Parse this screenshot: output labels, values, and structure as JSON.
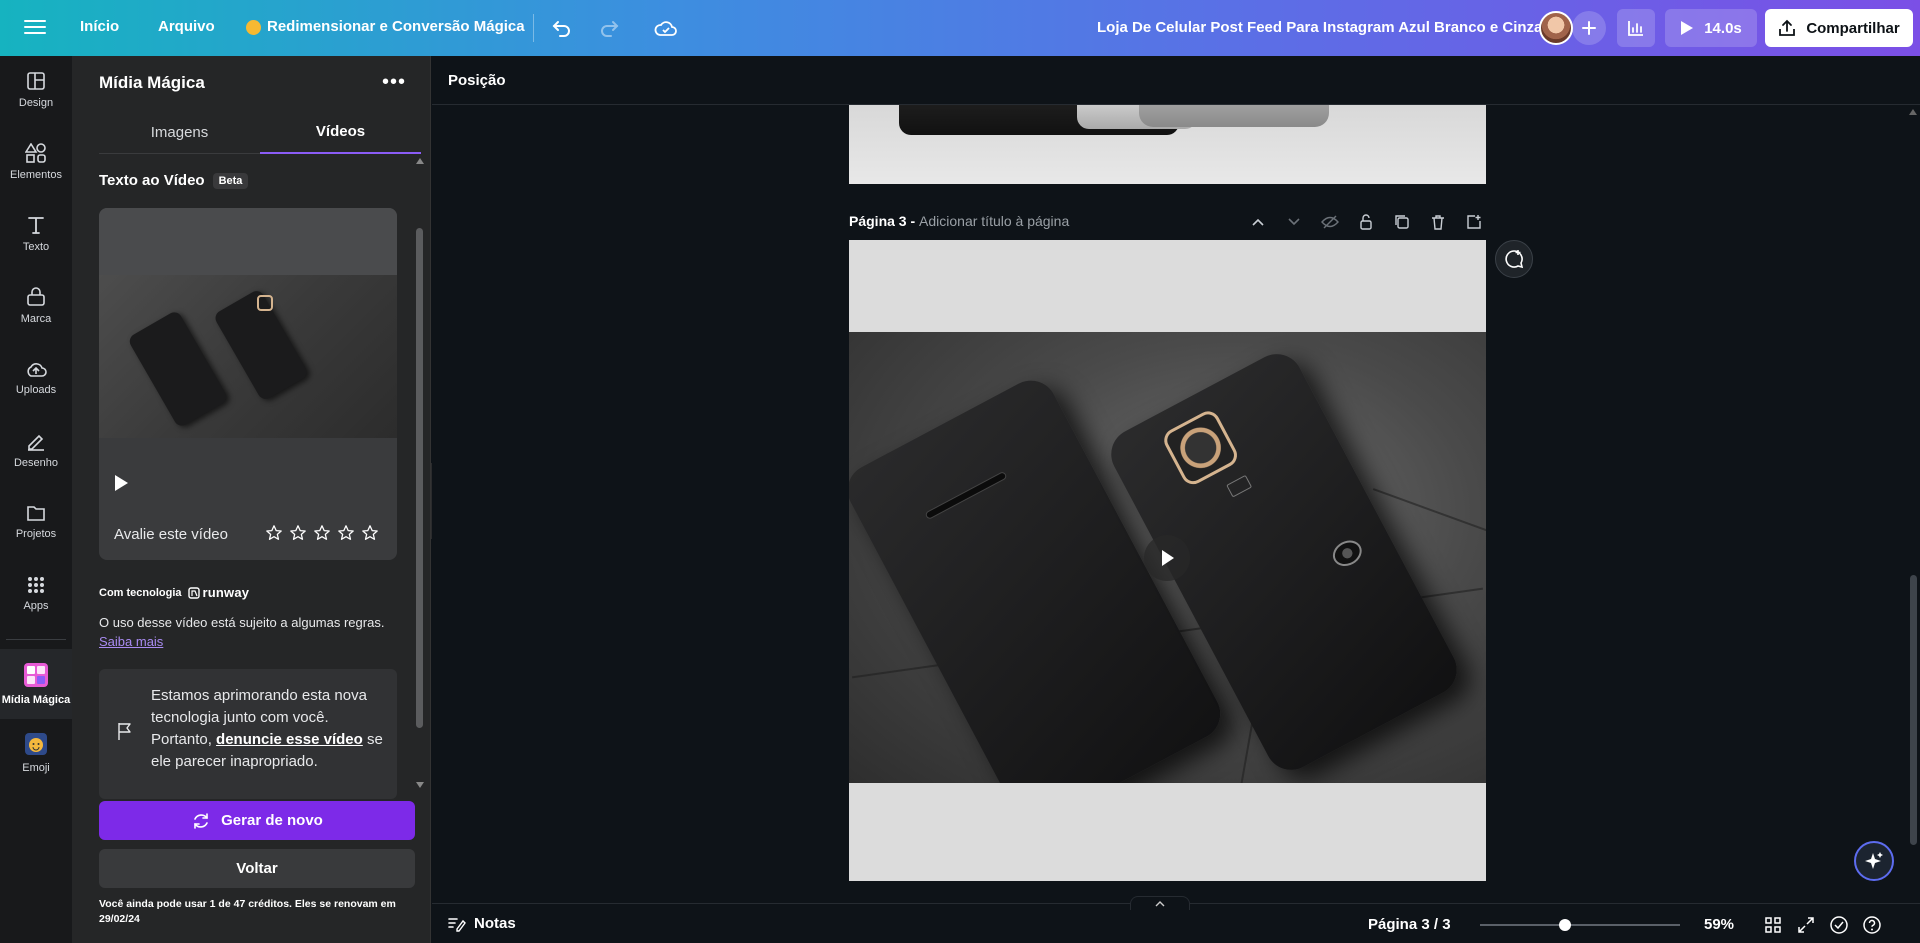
{
  "topbar": {
    "home": "Início",
    "file": "Arquivo",
    "magic_resize": "Redimensionar e Conversão Mágica",
    "design_title": "Loja De Celular Post Feed Para Instagram Azul Branco e Cinza",
    "play_duration": "14.0s",
    "share": "Compartilhar",
    "icons": [
      "menu-icon",
      "undo-icon",
      "redo-icon",
      "cloud-save-icon",
      "plus-icon",
      "analytics-icon",
      "play-icon",
      "share-icon"
    ]
  },
  "rail": {
    "items": [
      {
        "label": "Design",
        "icon": "layout-icon"
      },
      {
        "label": "Elementos",
        "icon": "shapes-icon"
      },
      {
        "label": "Texto",
        "icon": "text-icon"
      },
      {
        "label": "Marca",
        "icon": "brand-icon"
      },
      {
        "label": "Uploads",
        "icon": "upload-icon"
      },
      {
        "label": "Desenho",
        "icon": "draw-icon"
      },
      {
        "label": "Projetos",
        "icon": "folder-icon"
      },
      {
        "label": "Apps",
        "icon": "apps-icon"
      },
      {
        "label": "Mídia Mágica",
        "icon": "magic-media-icon"
      },
      {
        "label": "Emoji",
        "icon": "emoji-icon"
      }
    ],
    "active": "Mídia Mágica"
  },
  "panel": {
    "title": "Mídia Mágica",
    "tabs": [
      "Imagens",
      "Vídeos"
    ],
    "active_tab": "Vídeos",
    "section_title": "Texto ao Vídeo",
    "badge": "Beta",
    "rate_label": "Avalie este vídeo",
    "rating_max": 5,
    "powered_by": "Com tecnologia",
    "powered_brand": "runway",
    "rules_text": "O uso desse vídeo está sujeito a algumas regras.",
    "learn_more": "Saiba mais",
    "notice_pre": "Estamos aprimorando esta nova tecnologia junto com você. Portanto, ",
    "notice_link": "denuncie esse vídeo",
    "notice_post": " se ele parecer inapropriado.",
    "regenerate": "Gerar de novo",
    "back": "Voltar",
    "credits": "Você ainda pode usar 1 de 47 créditos. Eles se renovam em 29/02/24"
  },
  "canvas": {
    "position_label": "Posição",
    "page_label": "Página 3 -",
    "page_title_placeholder": "Adicionar título à página",
    "page_tools": [
      "chevron-up-icon",
      "chevron-down-icon",
      "hide-icon",
      "lock-icon",
      "duplicate-icon",
      "trash-icon",
      "add-page-icon"
    ]
  },
  "bottombar": {
    "notes": "Notas",
    "pager": "Página 3 / 3",
    "zoom": "59%",
    "zoom_value": 0.59
  },
  "colors": {
    "accent_purple": "#7d2ae8",
    "tab_underline": "#8b5cf6",
    "link": "#a98bf2",
    "canvas_bg": "#0e1318"
  }
}
